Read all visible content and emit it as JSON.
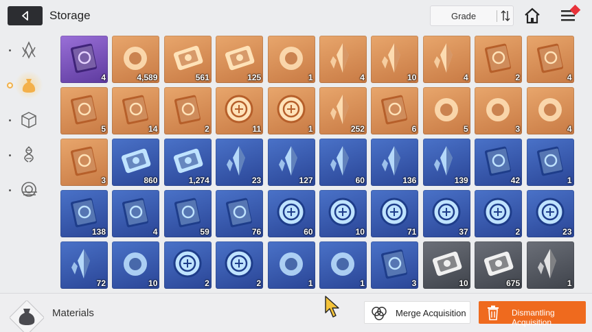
{
  "header": {
    "title": "Storage",
    "sort_label": "Grade",
    "back_icon": "back-arrow-icon",
    "sort_icon": "sort-order-icon",
    "home_icon": "home-icon",
    "menu_icon": "hamburger-menu-icon"
  },
  "sidebar": {
    "items": [
      {
        "name": "sidebar-item-crystals",
        "icon": "crystal-icon"
      },
      {
        "name": "sidebar-item-materials",
        "icon": "bag-icon",
        "active": true
      },
      {
        "name": "sidebar-item-cubes",
        "icon": "cube-icon"
      },
      {
        "name": "sidebar-item-dna",
        "icon": "dna-icon"
      },
      {
        "name": "sidebar-item-vortex",
        "icon": "vortex-icon"
      }
    ]
  },
  "items": [
    {
      "qty": "4",
      "rarity": "purple",
      "icon": "eye-card-icon"
    },
    {
      "qty": "4,589",
      "rarity": "orange",
      "icon": "blue-flame-orb-icon"
    },
    {
      "qty": "561",
      "rarity": "orange",
      "icon": "gold-ticket-icon"
    },
    {
      "qty": "125",
      "rarity": "orange",
      "icon": "gold-ticket-star-icon"
    },
    {
      "qty": "1",
      "rarity": "orange",
      "icon": "purple-eye-icon"
    },
    {
      "qty": "4",
      "rarity": "orange",
      "icon": "gold-feather-icon"
    },
    {
      "qty": "10",
      "rarity": "orange",
      "icon": "pink-crystal-icon"
    },
    {
      "qty": "4",
      "rarity": "orange",
      "icon": "blue-crystal-icon"
    },
    {
      "qty": "2",
      "rarity": "orange",
      "icon": "book-x-icon"
    },
    {
      "qty": "4",
      "rarity": "orange",
      "icon": "book-shield-icon"
    },
    {
      "qty": "5",
      "rarity": "orange",
      "icon": "book-eye-icon"
    },
    {
      "qty": "14",
      "rarity": "orange",
      "icon": "book-blade-icon"
    },
    {
      "qty": "2",
      "rarity": "orange",
      "icon": "book-target-icon"
    },
    {
      "qty": "11",
      "rarity": "orange",
      "icon": "gold-medal-shield-icon"
    },
    {
      "qty": "1",
      "rarity": "orange",
      "icon": "gold-medal-target-icon"
    },
    {
      "qty": "252",
      "rarity": "orange",
      "icon": "gold-shards-icon"
    },
    {
      "qty": "6",
      "rarity": "orange",
      "icon": "star-book-icon"
    },
    {
      "qty": "5",
      "rarity": "orange",
      "icon": "spray-gun-icon"
    },
    {
      "qty": "3",
      "rarity": "orange",
      "icon": "document-stack-icon"
    },
    {
      "qty": "4",
      "rarity": "orange",
      "icon": "letter-icon"
    },
    {
      "qty": "3",
      "rarity": "orange",
      "icon": "dark-journal-icon"
    },
    {
      "qty": "860",
      "rarity": "blue",
      "icon": "blue-ticket-icon"
    },
    {
      "qty": "1,274",
      "rarity": "blue",
      "icon": "blue-ticket-star-icon"
    },
    {
      "qty": "23",
      "rarity": "blue",
      "icon": "red-crystal-icon"
    },
    {
      "qty": "127",
      "rarity": "blue",
      "icon": "orange-crystal-icon"
    },
    {
      "qty": "60",
      "rarity": "blue",
      "icon": "purple-crystal-icon"
    },
    {
      "qty": "136",
      "rarity": "blue",
      "icon": "green-crystal-icon"
    },
    {
      "qty": "139",
      "rarity": "blue",
      "icon": "teal-crystal-icon"
    },
    {
      "qty": "42",
      "rarity": "blue",
      "icon": "book-x-icon"
    },
    {
      "qty": "1",
      "rarity": "blue",
      "icon": "book-shield-icon"
    },
    {
      "qty": "138",
      "rarity": "blue",
      "icon": "book-eye-icon"
    },
    {
      "qty": "4",
      "rarity": "blue",
      "icon": "book-blade-icon"
    },
    {
      "qty": "59",
      "rarity": "blue",
      "icon": "book-cross-icon"
    },
    {
      "qty": "76",
      "rarity": "blue",
      "icon": "book-target-icon"
    },
    {
      "qty": "60",
      "rarity": "blue",
      "icon": "silver-medal-cross-icon"
    },
    {
      "qty": "10",
      "rarity": "blue",
      "icon": "silver-medal-shield-icon"
    },
    {
      "qty": "71",
      "rarity": "blue",
      "icon": "silver-medal-eye-icon"
    },
    {
      "qty": "37",
      "rarity": "blue",
      "icon": "silver-medal-blade-icon"
    },
    {
      "qty": "2",
      "rarity": "blue",
      "icon": "silver-medal-x-icon"
    },
    {
      "qty": "23",
      "rarity": "blue",
      "icon": "silver-medal-target-icon"
    },
    {
      "qty": "72",
      "rarity": "blue",
      "icon": "ice-crystal-icon"
    },
    {
      "qty": "10",
      "rarity": "blue",
      "icon": "cake-icon"
    },
    {
      "qty": "2",
      "rarity": "blue",
      "icon": "pocket-watch-icon"
    },
    {
      "qty": "2",
      "rarity": "blue",
      "icon": "star-badge-icon"
    },
    {
      "qty": "1",
      "rarity": "blue",
      "icon": "pouch-icon"
    },
    {
      "qty": "1",
      "rarity": "blue",
      "icon": "flower-bouquet-icon"
    },
    {
      "qty": "3",
      "rarity": "blue",
      "icon": "blue-certificate-icon"
    },
    {
      "qty": "10",
      "rarity": "grey",
      "icon": "silver-ticket-icon"
    },
    {
      "qty": "675",
      "rarity": "grey",
      "icon": "silver-ticket-star-icon"
    },
    {
      "qty": "1",
      "rarity": "grey",
      "icon": "brown-crystal-icon"
    }
  ],
  "footer": {
    "category_label": "Materials",
    "category_icon": "material-bag-icon",
    "merge_label": "Merge Acquisition",
    "dismantle_label": "Dismantling Acquisition"
  },
  "colors": {
    "accent": "#ef6a1e",
    "rarity_orange": "#d88a52",
    "rarity_blue": "#3a5cb0",
    "rarity_purple": "#7b56be",
    "rarity_grey": "#55595f"
  }
}
